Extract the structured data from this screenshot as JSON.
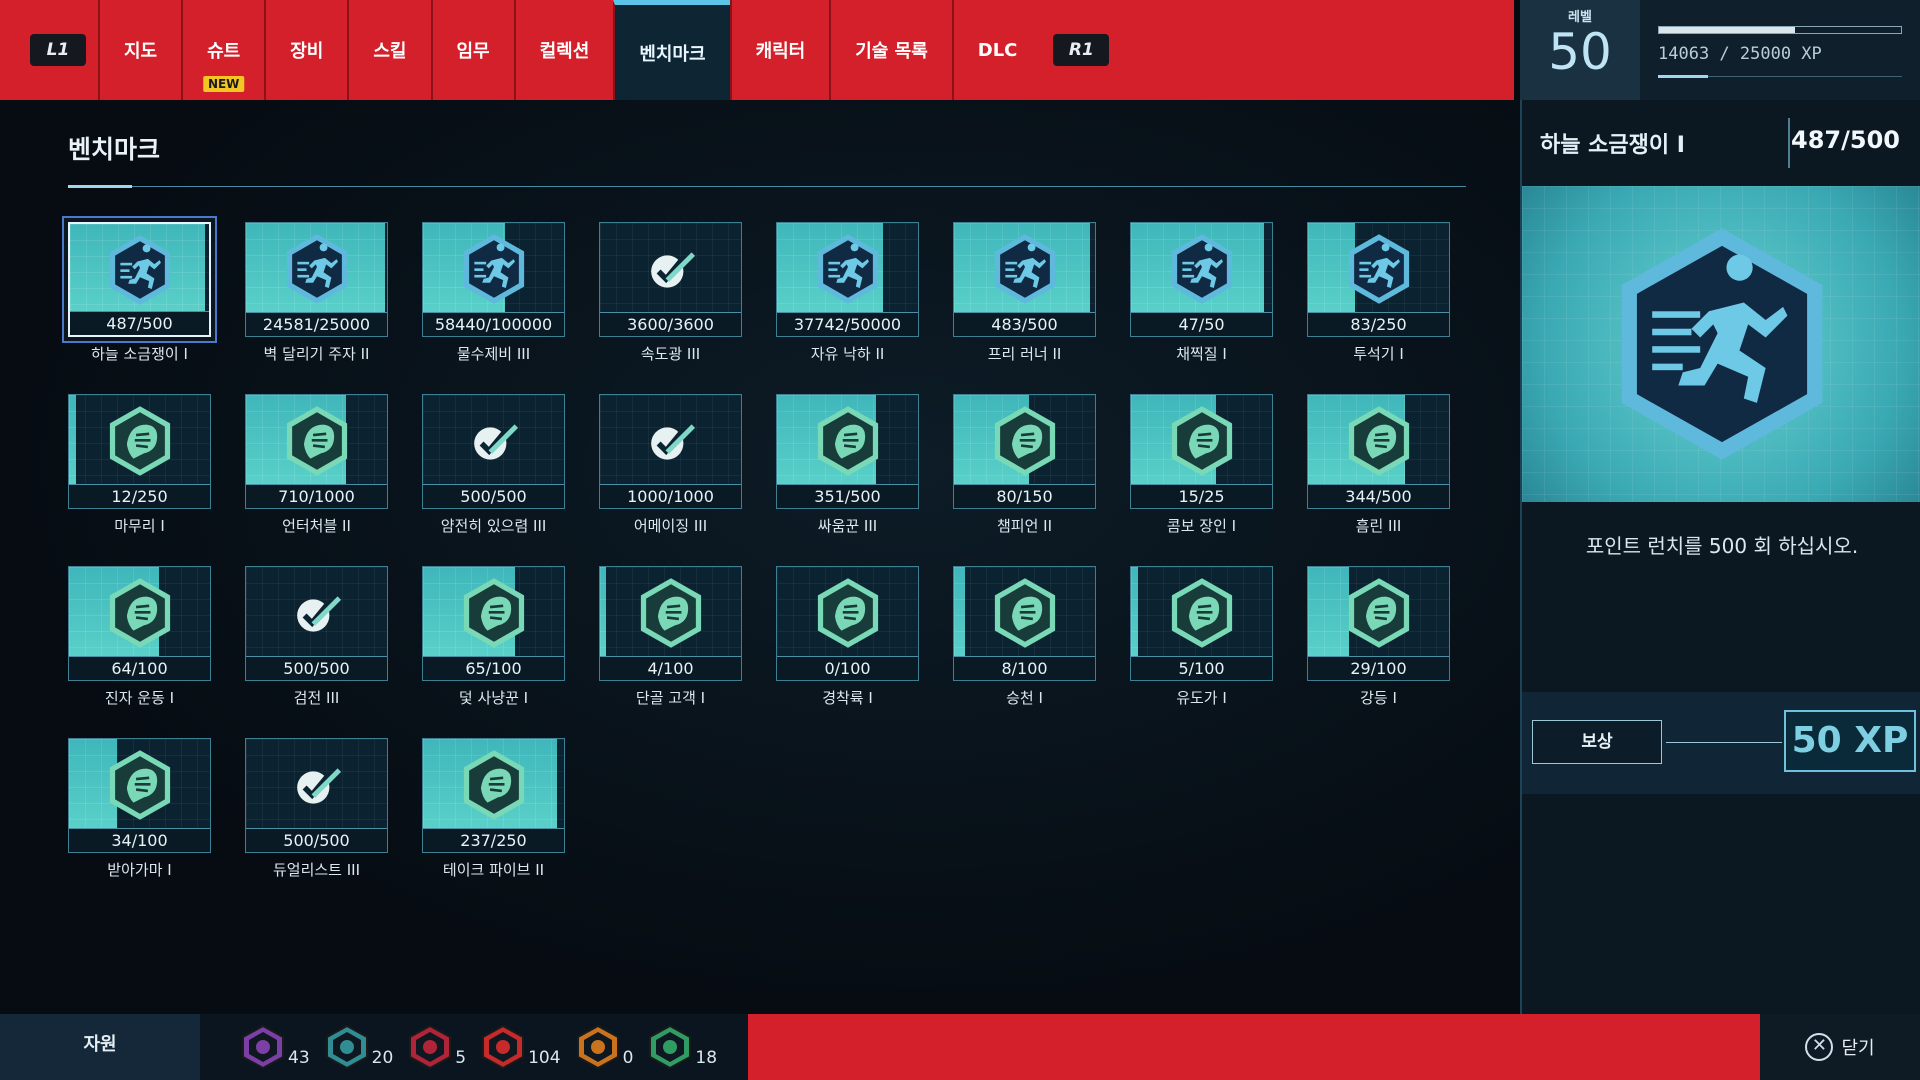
{
  "nav": {
    "l1": "L1",
    "r1": "R1",
    "tabs": [
      {
        "label": "지도"
      },
      {
        "label": "슈트",
        "badge": "NEW"
      },
      {
        "label": "장비"
      },
      {
        "label": "스킬"
      },
      {
        "label": "임무"
      },
      {
        "label": "컬렉션"
      },
      {
        "label": "벤치마크",
        "active": true
      },
      {
        "label": "캐릭터"
      },
      {
        "label": "기술 목록"
      },
      {
        "label": "DLC"
      }
    ]
  },
  "level": {
    "label": "레벨",
    "value": "50"
  },
  "xp": {
    "text": "14063 / 25000 XP",
    "fraction": 0.5625
  },
  "main": {
    "title": "벤치마크"
  },
  "benchmarks": [
    {
      "name": "하늘 소금쟁이 I",
      "count": "487/500",
      "icon": "runner-icon",
      "progress": 0.974,
      "selected": true
    },
    {
      "name": "벽 달리기 주자 II",
      "count": "24581/25000",
      "icon": "runner-icon",
      "progress": 0.983
    },
    {
      "name": "물수제비 III",
      "count": "58440/100000",
      "icon": "runner-icon",
      "progress": 0.584
    },
    {
      "name": "속도광 III",
      "count": "3600/3600",
      "icon": "check-icon",
      "progress": 1
    },
    {
      "name": "자유 낙하 II",
      "count": "37742/50000",
      "icon": "runner-icon",
      "progress": 0.755
    },
    {
      "name": "프리 러너 II",
      "count": "483/500",
      "icon": "runner-icon",
      "progress": 0.966
    },
    {
      "name": "채찍질 I",
      "count": "47/50",
      "icon": "runner-icon",
      "progress": 0.94
    },
    {
      "name": "투석기 I",
      "count": "83/250",
      "icon": "runner-icon",
      "progress": 0.332
    },
    {
      "name": "마무리 I",
      "count": "12/250",
      "icon": "fist-icon",
      "progress": 0.048
    },
    {
      "name": "언터처블 II",
      "count": "710/1000",
      "icon": "fist-icon",
      "progress": 0.71
    },
    {
      "name": "얌전히 있으렴 III",
      "count": "500/500",
      "icon": "check-icon",
      "progress": 1
    },
    {
      "name": "어메이징 III",
      "count": "1000/1000",
      "icon": "check-icon",
      "progress": 1
    },
    {
      "name": "싸움꾼 III",
      "count": "351/500",
      "icon": "fist-icon",
      "progress": 0.702
    },
    {
      "name": "챔피언 II",
      "count": "80/150",
      "icon": "fist-icon",
      "progress": 0.533
    },
    {
      "name": "콤보 장인 I",
      "count": "15/25",
      "icon": "fist-icon",
      "progress": 0.6
    },
    {
      "name": "흠린 III",
      "count": "344/500",
      "icon": "fist-icon",
      "progress": 0.688
    },
    {
      "name": "진자 운동 I",
      "count": "64/100",
      "icon": "fist-icon",
      "progress": 0.64
    },
    {
      "name": "검전 III",
      "count": "500/500",
      "icon": "check-icon",
      "progress": 1
    },
    {
      "name": "덫 사냥꾼 I",
      "count": "65/100",
      "icon": "fist-icon",
      "progress": 0.65
    },
    {
      "name": "단골 고객 I",
      "count": "4/100",
      "icon": "fist-icon",
      "progress": 0.04
    },
    {
      "name": "경착륙 I",
      "count": "0/100",
      "icon": "fist-icon",
      "progress": 0
    },
    {
      "name": "승천 I",
      "count": "8/100",
      "icon": "fist-icon",
      "progress": 0.08
    },
    {
      "name": "유도가 I",
      "count": "5/100",
      "icon": "fist-icon",
      "progress": 0.05
    },
    {
      "name": "강등 I",
      "count": "29/100",
      "icon": "fist-icon",
      "progress": 0.29
    },
    {
      "name": "받아가마 I",
      "count": "34/100",
      "icon": "fist-icon",
      "progress": 0.34
    },
    {
      "name": "듀얼리스트 III",
      "count": "500/500",
      "icon": "check-icon",
      "progress": 1
    },
    {
      "name": "테이크 파이브 II",
      "count": "237/250",
      "icon": "fist-icon",
      "progress": 0.948
    }
  ],
  "detail": {
    "title": "하늘 소금쟁이 I",
    "progress": "487/500",
    "description": "포인트 런치를 500 회 하십시오.",
    "reward_label": "보상",
    "reward_value": "50 XP",
    "icon": "runner-icon"
  },
  "resources": {
    "label": "자원",
    "items": [
      {
        "icon": "research-token-icon",
        "value": "43",
        "color": "#7b3fa6"
      },
      {
        "icon": "city-token-icon",
        "value": "20",
        "color": "#2f8d93"
      },
      {
        "icon": "landmark-token-icon",
        "value": "5",
        "color": "#b0243a"
      },
      {
        "icon": "crime-token-icon",
        "value": "104",
        "color": "#c62a2a"
      },
      {
        "icon": "challenge-token-icon",
        "value": "0",
        "color": "#c9731f"
      },
      {
        "icon": "backpack-token-icon",
        "value": "18",
        "color": "#2f9d63"
      }
    ]
  },
  "close": {
    "label": "닫기"
  }
}
